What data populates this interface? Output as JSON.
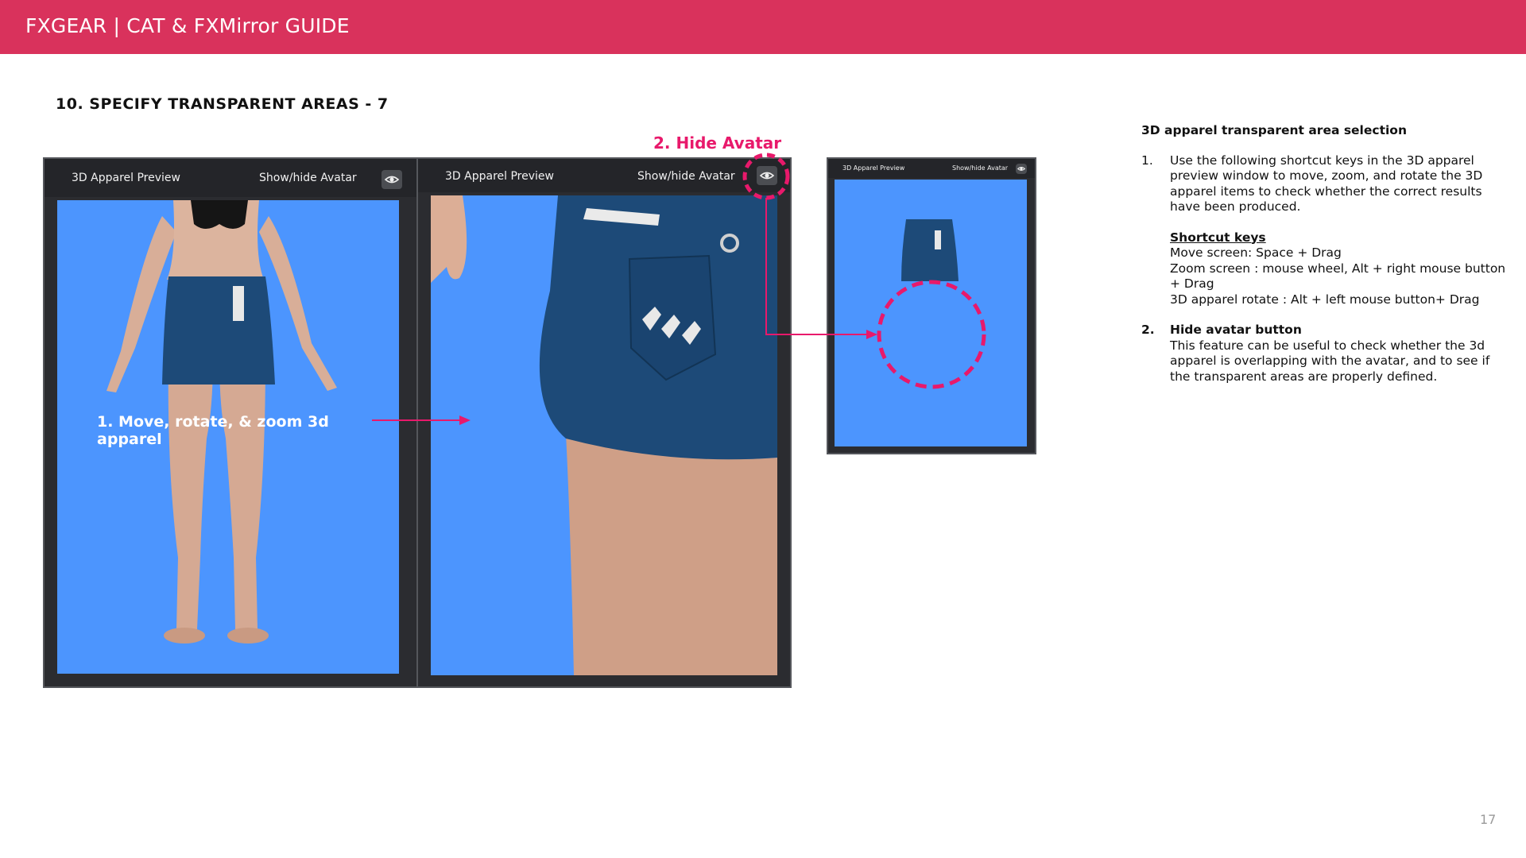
{
  "header": {
    "title": "FXGEAR | CAT & FXMirror GUIDE"
  },
  "section_title": "10. SPECIFY TRANSPARENT AREAS - 7",
  "panels": [
    {
      "title": "3D Apparel Preview",
      "toggle": "Show/hide Avatar"
    },
    {
      "title": "3D Apparel Preview",
      "toggle": "Show/hide Avatar"
    },
    {
      "title": "3D Apparel Preview",
      "toggle": "Show/hide Avatar"
    }
  ],
  "callouts": {
    "move": "1. Move, rotate, & zoom 3d apparel",
    "hide": "2. Hide Avatar"
  },
  "guide": {
    "heading": "3D apparel transparent area selection",
    "step1_num": "1.",
    "step1_text": "Use the following shortcut keys in the 3D apparel preview window to move, zoom, and rotate the 3D apparel items to check whether the correct results have been produced.",
    "shortcut_heading": "Shortcut keys",
    "shortcuts": [
      "Move screen: Space + Drag",
      "Zoom screen : mouse wheel, Alt + right mouse button + Drag",
      "3D apparel rotate : Alt + left mouse button+ Drag"
    ],
    "step2_num": "2.",
    "step2_title": "Hide avatar button",
    "step2_text": "This feature can be useful to check whether the 3d apparel is overlapping with the avatar, and to see if the transparent areas are properly defined."
  },
  "page_number": "17",
  "colors": {
    "accent": "#d9325c",
    "callout_pink": "#e8196b",
    "viewport_blue": "#4c95fe",
    "panel_dark": "#2b2c30",
    "skirt_navy": "#1d4a78"
  }
}
